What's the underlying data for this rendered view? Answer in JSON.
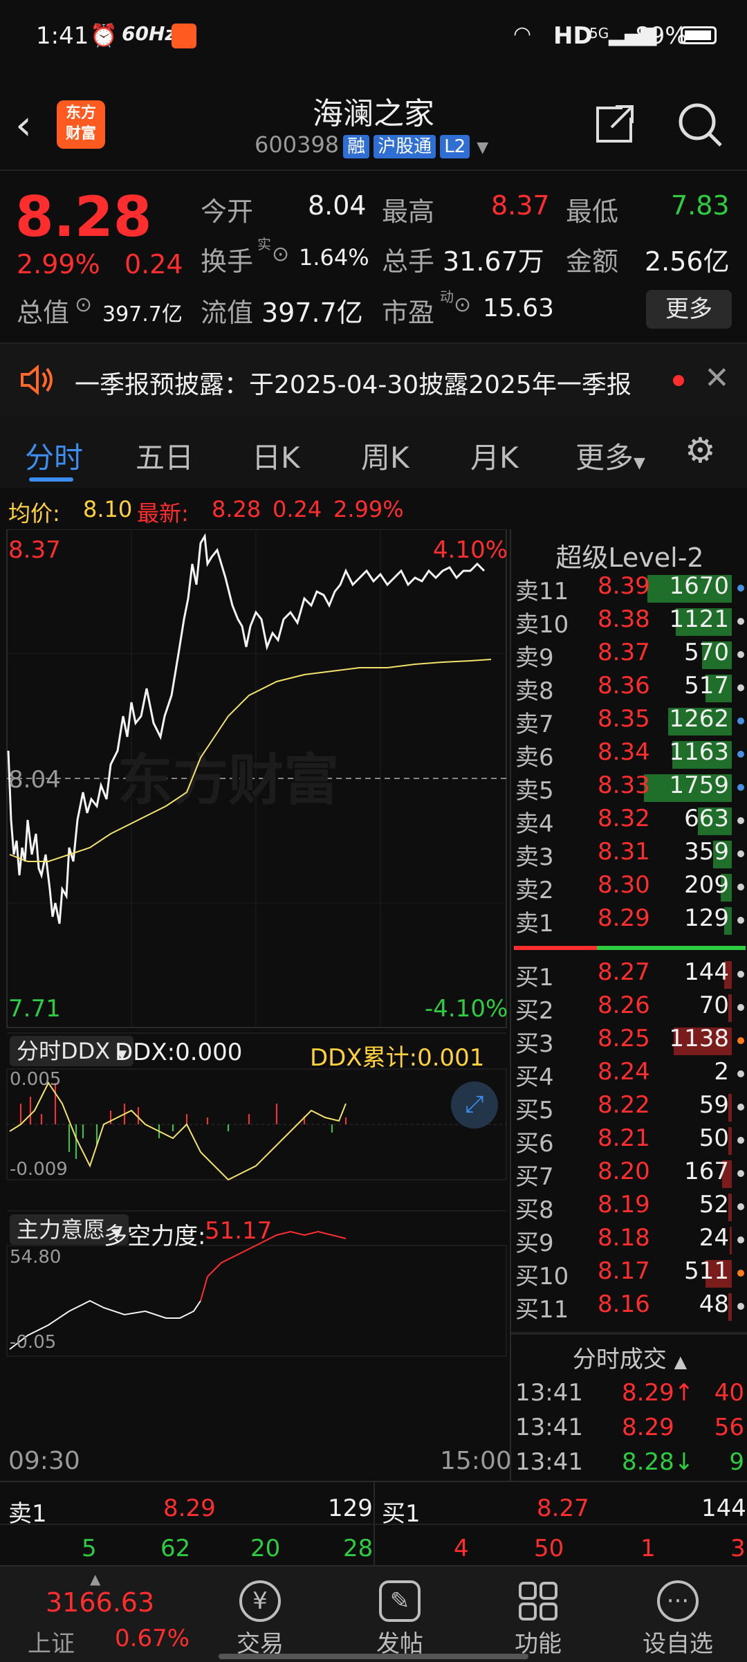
{
  "status": {
    "time": "1:41",
    "hz": "60Hz",
    "network": "HD",
    "signal": "5G",
    "battery": "89%"
  },
  "nav": {
    "logo_line1": "东方",
    "logo_line2": "财富",
    "title": "海澜之家",
    "code": "600398",
    "tags": [
      "融",
      "沪股通",
      "L2"
    ]
  },
  "quote": {
    "price": "8.28",
    "pct": "2.99%",
    "chg": "0.24",
    "open_label": "今开",
    "open": "8.04",
    "high_label": "最高",
    "high": "8.37",
    "low_label": "最低",
    "low": "7.83",
    "turnover_label": "换手",
    "turnover_sup": "实",
    "turnover": "1.64%",
    "volume_label": "总手",
    "volume": "31.67万",
    "amount_label": "金额",
    "amount": "2.56亿",
    "mcap_label": "总值",
    "mcap": "397.7亿",
    "float_label": "流值",
    "float": "397.7亿",
    "pe_label": "市盈",
    "pe_sup": "动",
    "pe": "15.63",
    "more": "更多"
  },
  "notice": {
    "text": "一季报预披露：于2025-04-30披露2025年一季报"
  },
  "tabs": [
    "分时",
    "五日",
    "日K",
    "周K",
    "月K",
    "更多"
  ],
  "avg": {
    "label": "均价:",
    "avg": "8.10",
    "latest_label": "最新:",
    "latest": "8.28",
    "chg": "0.24",
    "pct": "2.99%"
  },
  "chart": {
    "high": "8.37",
    "high_pct": "4.10%",
    "mid": "8.04",
    "low": "7.71",
    "low_pct": "-4.10%",
    "watermark": "东方财富",
    "ddx_tab": "分时DDX",
    "ddx": "DDX:0.000",
    "ddx_cum": "DDX累计:0.001",
    "ddx_top": "0.005",
    "ddx_bottom": "-0.009",
    "zl_tab": "主力意愿",
    "zl_label": "多空力度:",
    "zl_val": "51.17",
    "zl_top": "54.80",
    "zl_bottom": "-0.05",
    "t_start": "09:30",
    "t_end": "15:00"
  },
  "book": {
    "title": "超级Level-2",
    "asks": [
      {
        "n": "卖11",
        "p": "8.39",
        "v": "1670",
        "w": 0.45,
        "dot": "#4a90e2"
      },
      {
        "n": "卖10",
        "p": "8.38",
        "v": "1121",
        "w": 0.3,
        "dot": "#cfcfcf"
      },
      {
        "n": "卖9",
        "p": "8.37",
        "v": "570",
        "w": 0.16,
        "dot": "#cfcfcf"
      },
      {
        "n": "卖8",
        "p": "8.36",
        "v": "517",
        "w": 0.14,
        "dot": "#cfcfcf"
      },
      {
        "n": "卖7",
        "p": "8.35",
        "v": "1262",
        "w": 0.34,
        "dot": "#4a90e2"
      },
      {
        "n": "卖6",
        "p": "8.34",
        "v": "1163",
        "w": 0.32,
        "dot": "#4a90e2"
      },
      {
        "n": "卖5",
        "p": "8.33",
        "v": "1759",
        "w": 0.47,
        "dot": "#4a90e2"
      },
      {
        "n": "卖4",
        "p": "8.32",
        "v": "663",
        "w": 0.18,
        "dot": "#cfcfcf"
      },
      {
        "n": "卖3",
        "p": "8.31",
        "v": "359",
        "w": 0.1,
        "dot": "#cfcfcf"
      },
      {
        "n": "卖2",
        "p": "8.30",
        "v": "209",
        "w": 0.06,
        "dot": "#cfcfcf"
      },
      {
        "n": "卖1",
        "p": "8.29",
        "v": "129",
        "w": 0.04,
        "dot": "#cfcfcf"
      }
    ],
    "bids": [
      {
        "n": "买1",
        "p": "8.27",
        "v": "144",
        "w": 0.04,
        "dot": "#cfcfcf"
      },
      {
        "n": "买2",
        "p": "8.26",
        "v": "70",
        "w": 0.02,
        "dot": "#cfcfcf"
      },
      {
        "n": "买3",
        "p": "8.25",
        "v": "1138",
        "w": 0.31,
        "dot": "#ff7a1a"
      },
      {
        "n": "买4",
        "p": "8.24",
        "v": "2",
        "w": 0.0,
        "dot": "#cfcfcf"
      },
      {
        "n": "买5",
        "p": "8.22",
        "v": "59",
        "w": 0.02,
        "dot": "#cfcfcf"
      },
      {
        "n": "买6",
        "p": "8.21",
        "v": "50",
        "w": 0.02,
        "dot": "#cfcfcf"
      },
      {
        "n": "买7",
        "p": "8.20",
        "v": "167",
        "w": 0.05,
        "dot": "#cfcfcf"
      },
      {
        "n": "买8",
        "p": "8.19",
        "v": "52",
        "w": 0.02,
        "dot": "#cfcfcf"
      },
      {
        "n": "买9",
        "p": "8.18",
        "v": "24",
        "w": 0.01,
        "dot": "#cfcfcf"
      },
      {
        "n": "买10",
        "p": "8.17",
        "v": "511",
        "w": 0.14,
        "dot": "#ff7a1a"
      },
      {
        "n": "买11",
        "p": "8.16",
        "v": "48",
        "w": 0.02,
        "dot": "#cfcfcf"
      }
    ],
    "trades_title": "分时成交",
    "trades": [
      {
        "t": "13:41",
        "p": "8.29",
        "arrow": "↑",
        "v": "40",
        "color": "#ff2e2e"
      },
      {
        "t": "13:41",
        "p": "8.29",
        "arrow": "",
        "v": "56",
        "color": "#ff2e2e"
      },
      {
        "t": "13:41",
        "p": "8.28",
        "arrow": "↓",
        "v": "9",
        "color": "#2ecc40"
      }
    ]
  },
  "bottom": {
    "ask_label": "卖1",
    "ask_price": "8.29",
    "ask_vol": "129",
    "bid_label": "买1",
    "bid_price": "8.27",
    "bid_vol": "144",
    "row2_left": [
      "5",
      "62",
      "20",
      "28"
    ],
    "row2_right": [
      "4",
      "50",
      "1",
      "3"
    ]
  },
  "dock": {
    "index_val": "3166.63",
    "index_name": "上证",
    "index_pct": "0.67%",
    "items": [
      "交易",
      "发帖",
      "功能",
      "设自选"
    ]
  }
}
